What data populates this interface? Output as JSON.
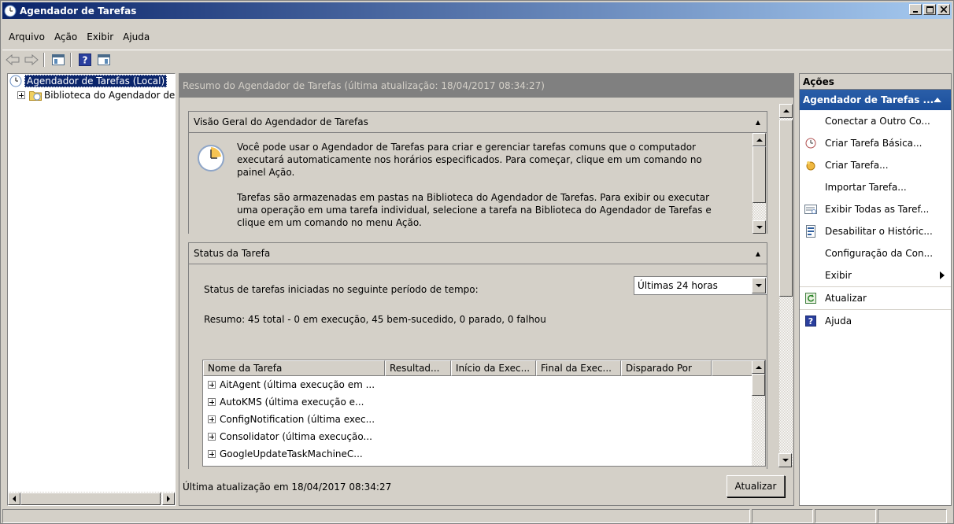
{
  "window": {
    "title": "Agendador de Tarefas"
  },
  "menu": {
    "items": [
      {
        "label": "Arquivo"
      },
      {
        "label": "Ação"
      },
      {
        "label": "Exibir"
      },
      {
        "label": "Ajuda"
      }
    ]
  },
  "tree": {
    "root": "Agendador de Tarefas (Local)",
    "child": "Biblioteca do Agendador de Tarefas"
  },
  "center": {
    "header": "Resumo do Agendador de Tarefas (última atualização: 18/04/2017 08:34:27)",
    "overview": {
      "title": "Visão Geral do Agendador de Tarefas",
      "para1": "Você pode usar o Agendador de Tarefas para criar e gerenciar tarefas comuns que o computador executará automaticamente nos horários especificados. Para começar, clique em um comando no painel Ação.",
      "para2": "Tarefas são armazenadas em pastas na Biblioteca do Agendador de Tarefas. Para exibir ou executar uma operação em uma tarefa individual, selecione a tarefa na Biblioteca do Agendador de Tarefas e clique em um comando no menu Ação."
    },
    "status": {
      "title": "Status da Tarefa",
      "period_label": "Status de tarefas iniciadas no seguinte período de tempo:",
      "period_value": "Últimas 24 horas",
      "summary": "Resumo: 45 total - 0 em execução, 45 bem-sucedido, 0 parado, 0 falhou"
    },
    "table": {
      "columns": [
        "Nome da Tarefa",
        "Resultad...",
        "Início da Exec...",
        "Final da Exec...",
        "Disparado Por"
      ],
      "rows": [
        "AitAgent (última execução em ...",
        "AutoKMS (última execução e...",
        "ConfigNotification (última exec...",
        "Consolidator (última execução...",
        "GoogleUpdateTaskMachineC..."
      ]
    },
    "footer": {
      "last_update": "Última atualização em 18/04/2017 08:34:27",
      "refresh_button": "Atualizar"
    }
  },
  "actions": {
    "title": "Ações",
    "group": "Agendador de Tarefas ...",
    "items": [
      {
        "label": "Conectar a Outro Co...",
        "icon": "none"
      },
      {
        "label": "Criar Tarefa Básica...",
        "icon": "clock-wizard-icon"
      },
      {
        "label": "Criar Tarefa...",
        "icon": "new-task-icon"
      },
      {
        "label": "Importar Tarefa...",
        "icon": "none"
      },
      {
        "label": "Exibir Todas as Taref...",
        "icon": "task-list-icon"
      },
      {
        "label": "Desabilitar o Históric...",
        "icon": "history-icon"
      },
      {
        "label": "Configuração da Con...",
        "icon": "none"
      },
      {
        "label": "Exibir",
        "icon": "none"
      },
      {
        "label": "Atualizar",
        "icon": "refresh-icon"
      },
      {
        "label": "Ajuda",
        "icon": "help-icon"
      }
    ]
  },
  "colors": {
    "titlebar_start": "#0a246a",
    "titlebar_end": "#a6caf0",
    "actions_group": "#1b4f9c",
    "chrome": "#d4d0c8"
  }
}
